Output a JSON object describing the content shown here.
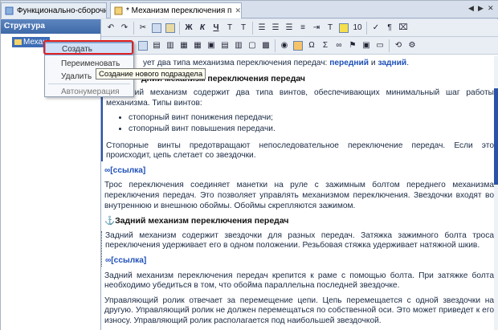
{
  "tabs": [
    {
      "label": "Функционально-сборочная",
      "close": "✕"
    },
    {
      "label": "* Механизм переключения п",
      "close": "✕"
    }
  ],
  "tab_controls": {
    "prev": "◀",
    "next": "▶",
    "close": "✕"
  },
  "left_panel": {
    "header": "Структура",
    "tree_item": "Механ"
  },
  "context_menu": {
    "items": [
      "Создать",
      "Переименовать",
      "Удалить",
      "Автонумерация"
    ],
    "tooltip": "Создание нового подраздела"
  },
  "toolbar": {
    "bold": "Ж",
    "italic": "К",
    "underline": "Ч",
    "t_sup": "T",
    "t_sub": "T",
    "font_size": "10",
    "omega": "Ω",
    "sigma": "Σ",
    "pilcrow": "¶"
  },
  "doc": {
    "intro_pre": "ует два типа механизма переключения передач: ",
    "intro_link1": "передний",
    "intro_and": " и ",
    "intro_link2": "задний",
    "intro_end": ".",
    "h1": "дний механизм переключения передач",
    "p1": "Передний механизм содержит два типа винтов, обеспечивающих минимальный шаг работы механизма. Типы винтов:",
    "li1": "стопорный винт понижения передачи;",
    "li2": "стопорный винт повышения передачи.",
    "p2": "Стопорные винты предотвращают непоследовательное переключение передач. Если это происходит, цепь слетает со звездочки.",
    "link1": "[ссылка]",
    "p3": "Трос переключения соединяет манетки на руле с зажимным болтом переднего механизма переключения передач. Это позволяет управлять механизмом переключения. Звездочки входят во внутреннюю и внешнюю обоймы. Обоймы скрепляются зажимом.",
    "h2": "Задний механизм переключения передач",
    "p4": "Задний механизм содержит звездочки для разных передач. Затяжка зажимного болта троса переключения удерживает его в одном положении. Резьбовая стяжка удерживает натяжной шкив.",
    "link2": "[ссылка]",
    "p5": "Задний механизм переключения передач крепится к раме с помощью болта. При затяжке болта необходимо убедиться в том, что обойма параллельна последней звездочке.",
    "p6": "Управляющий ролик отвечает за перемещение цепи. Цепь перемещается с одной звездочки на другую. Управляющий ролик не должен перемещаться по собственной оси. Это может приведет к его износу. Управляющий ролик располагается под наибольшей звездочкой."
  },
  "colors": {
    "accent": "#2a52a8",
    "highlight_box": "#e02020",
    "header_bg": "#3e69a8"
  }
}
